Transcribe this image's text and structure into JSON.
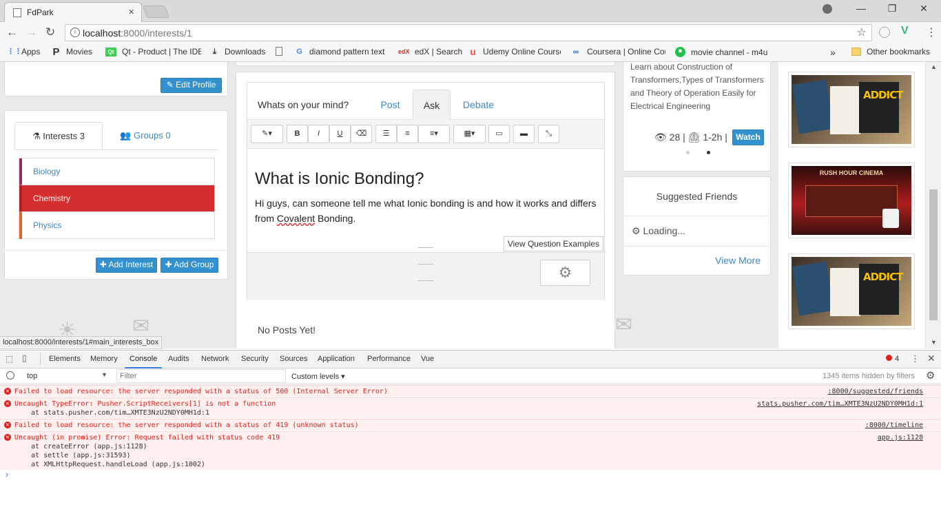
{
  "tab": {
    "title": "FdPark"
  },
  "window_controls": {
    "minimize": "—",
    "restore": "❐",
    "close": "✕"
  },
  "address": {
    "host": "localhost",
    "rest": ":8000/interests/1"
  },
  "bookmarks": [
    {
      "label": "Apps",
      "icon": "apps-grid-icon"
    },
    {
      "label": "Movies",
      "icon": "movies-p-icon"
    },
    {
      "label": "Qt - Product | The IDE",
      "icon": "qt-icon"
    },
    {
      "label": "Downloads",
      "icon": "download-icon"
    },
    {
      "label": "",
      "icon": "page-icon"
    },
    {
      "label": "diamond pattern text",
      "icon": "google-icon"
    },
    {
      "label": "edX | Search",
      "icon": "edx-icon"
    },
    {
      "label": "Udemy Online Course",
      "icon": "udemy-icon"
    },
    {
      "label": "Coursera | Online Cou",
      "icon": "coursera-icon"
    },
    {
      "label": "movie channel - m4u",
      "icon": "m4u-icon"
    }
  ],
  "bookmarks_overflow": "»",
  "other_bookmarks": "Other bookmarks",
  "profile": {
    "edit_button": "Edit Profile"
  },
  "interests_box": {
    "tabs": [
      {
        "label": "Interests 3"
      },
      {
        "label": "Groups 0"
      }
    ],
    "items": [
      {
        "label": "Biology",
        "color": "#9c2a5c"
      },
      {
        "label": "Chemistry",
        "color": "#d42e2e"
      },
      {
        "label": "Physics",
        "color": "#e0652a"
      }
    ],
    "add_interest": "Add Interest",
    "add_group": "Add Group"
  },
  "composer": {
    "prompt": "Whats on your mind?",
    "tabs": [
      {
        "label": "Post"
      },
      {
        "label": "Ask"
      },
      {
        "label": "Debate"
      }
    ],
    "heading": "What is Ionic Bonding?",
    "body_before": "Hi guys, can someone tell me what Ionic bonding is and how it works and differs from ",
    "body_link": "Covalent",
    "body_after": " Bonding.",
    "examples_button": "View Question Examples"
  },
  "feed": {
    "empty": "No Posts Yet!"
  },
  "video": {
    "description": "Learn about Construction of Transformers,Types of Transformers and Theory of Operation Easily for Electrical Engineering",
    "views": "28 |",
    "duration": "1-2h |",
    "watch": "Watch"
  },
  "suggested": {
    "title": "Suggested Friends",
    "loading": "Loading...",
    "view_more": "View More"
  },
  "ads": [
    {
      "title": "",
      "colors": [
        "#3a2f26",
        "#c2a67a"
      ]
    },
    {
      "title": "RUSH HOUR CINEMA",
      "colors": [
        "#2a0a0a",
        "#b01e1e"
      ]
    },
    {
      "title": "",
      "colors": [
        "#3a2f26",
        "#c2a67a"
      ]
    }
  ],
  "status_url": "localhost:8000/interests/1#main_interests_box",
  "devtools": {
    "tabs": [
      "Elements",
      "Memory",
      "Console",
      "Audits",
      "Network",
      "Security",
      "Sources",
      "Application",
      "Performance",
      "Vue"
    ],
    "error_count": "4",
    "context": "top",
    "filter_placeholder": "Filter",
    "levels": "Custom levels",
    "hidden": "1345 items hidden by filters",
    "messages": [
      {
        "text": "Failed to load resource: the server responded with a status of 500 (Internal Server Error)",
        "source": ":8000/suggested/friends",
        "lines": []
      },
      {
        "text": "Uncaught TypeError: Pusher.ScriptReceivers[1] is not a function",
        "source": "stats.pusher.com/tim…XMTE3NzU2NDY0MH1d:1",
        "lines": [
          "    at stats.pusher.com/tim…XMTE3NzU2NDY0MH1d:1"
        ]
      },
      {
        "text": "Failed to load resource: the server responded with a status of 419 (unknown status)",
        "source": ":8000/timeline",
        "lines": []
      },
      {
        "text": "Uncaught (in promise) Error: Request failed with status code 419",
        "source": "app.js:1128",
        "lines": [
          "    at createError (app.js:1128)",
          "    at settle (app.js:31593)",
          "    at XMLHttpRequest.handleLoad (app.js:1002)"
        ]
      }
    ],
    "prompt": "›"
  }
}
